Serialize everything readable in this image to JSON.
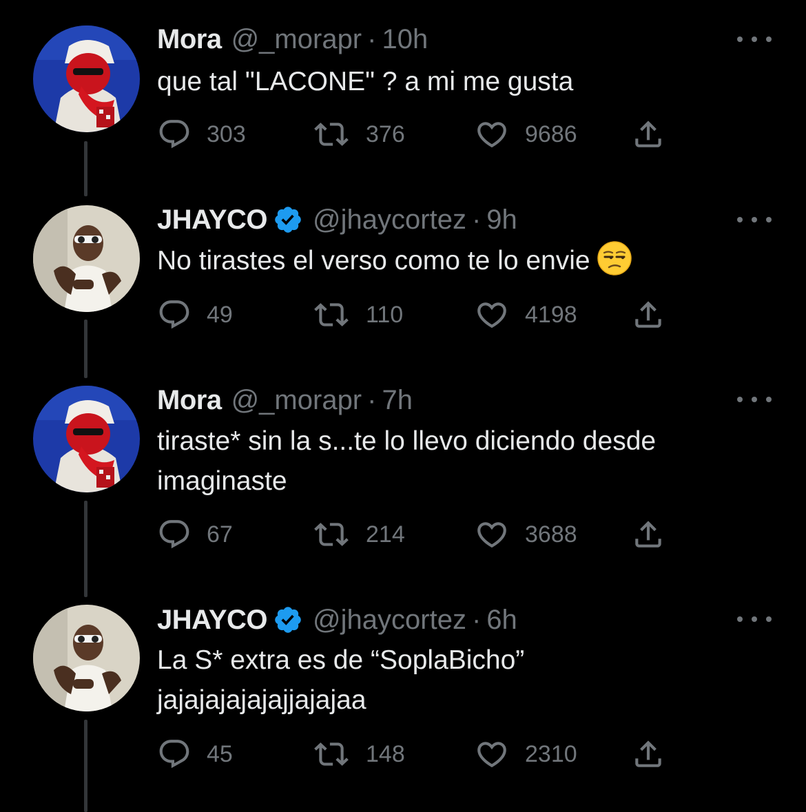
{
  "colors": {
    "background": "#000000",
    "text": "#e7e9ea",
    "muted": "#71767b",
    "verified": "#1d9bf0",
    "thread_line": "#333639"
  },
  "tweets": [
    {
      "name": "Mora",
      "handle": "@_morapr",
      "separator": "·",
      "time": "10h",
      "verified": false,
      "avatar": "mora-avatar",
      "lines": [
        "que tal \"LACONE\" ? a mi me gusta"
      ],
      "emoji": "",
      "replies": "303",
      "retweets": "376",
      "likes": "9686"
    },
    {
      "name": "JHAYCO",
      "handle": "@jhaycortez",
      "separator": "·",
      "time": "9h",
      "verified": true,
      "avatar": "jhayco-avatar",
      "lines": [
        "No tirastes el verso como te lo envie"
      ],
      "emoji": "unamused-face-emoji",
      "replies": "49",
      "retweets": "110",
      "likes": "4198"
    },
    {
      "name": "Mora",
      "handle": "@_morapr",
      "separator": "·",
      "time": "7h",
      "verified": false,
      "avatar": "mora-avatar",
      "lines": [
        "tiraste* sin la s...te lo llevo diciendo desde",
        "imaginaste"
      ],
      "emoji": "",
      "replies": "67",
      "retweets": "214",
      "likes": "3688"
    },
    {
      "name": "JHAYCO",
      "handle": "@jhaycortez",
      "separator": "·",
      "time": "6h",
      "verified": true,
      "avatar": "jhayco-avatar",
      "lines": [
        "La S* extra es de “SoplaBicho”",
        "jajajajajajajjajajaa"
      ],
      "emoji": "",
      "replies": "45",
      "retweets": "148",
      "likes": "2310"
    }
  ],
  "icons": {
    "reply": "reply-icon",
    "retweet": "retweet-icon",
    "like": "heart-icon",
    "share": "share-icon",
    "more": "more-icon",
    "verified": "verified-badge-icon"
  }
}
